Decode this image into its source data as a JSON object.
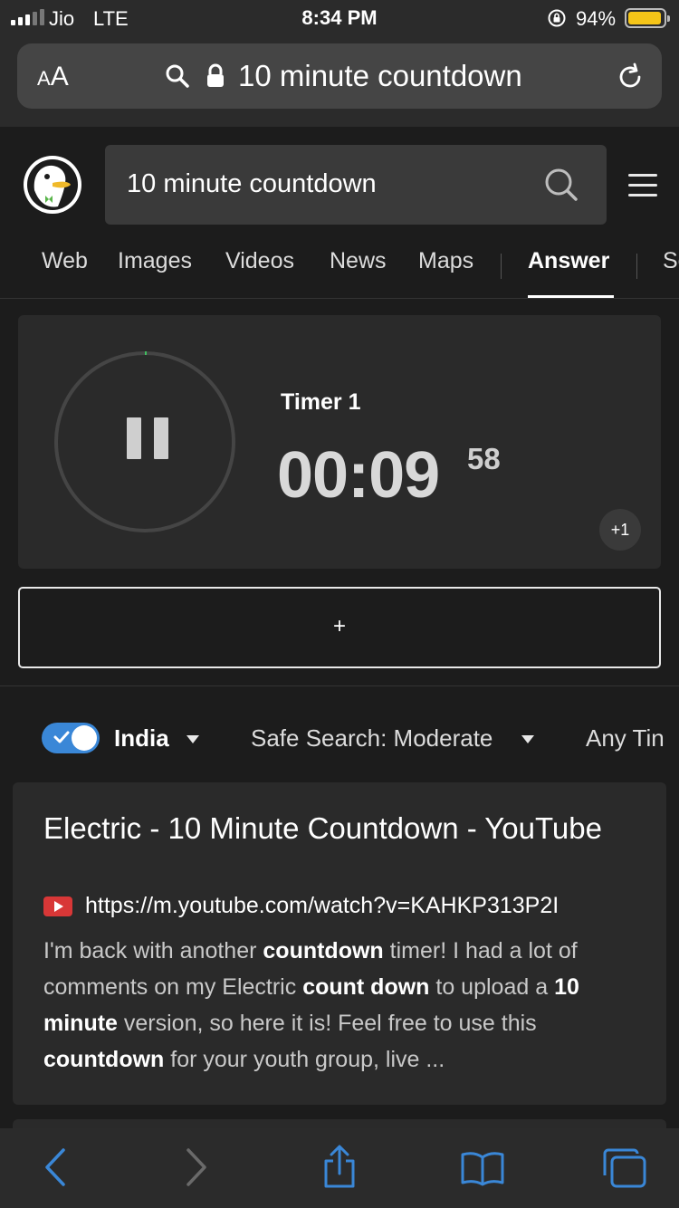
{
  "status_bar": {
    "carrier": "Jio",
    "network": "LTE",
    "time": "8:34 PM",
    "battery_percent": "94%",
    "battery_level": 0.94
  },
  "safari": {
    "text_size_label_small": "A",
    "text_size_label_large": "A",
    "address_text": "10 minute countdown"
  },
  "ddg": {
    "search_query": "10 minute countdown",
    "tabs": [
      {
        "label": "Web"
      },
      {
        "label": "Images"
      },
      {
        "label": "Videos"
      },
      {
        "label": "News"
      },
      {
        "label": "Maps"
      },
      {
        "label": "Answer"
      },
      {
        "label": "Se"
      }
    ],
    "active_tab": "Answer"
  },
  "timer": {
    "label": "Timer 1",
    "time": "00:09",
    "centiseconds": "58",
    "plus_one_label": "+1",
    "add_label": "+",
    "remaining_fraction": 0.995,
    "accent_color": "#3fbf5f"
  },
  "filters": {
    "region": "India",
    "region_enabled": true,
    "safe_search": "Safe Search: Moderate",
    "time_filter": "Any Tin"
  },
  "result": {
    "title": "Electric - 10 Minute Countdown - YouTube",
    "url": "https://m.youtube.com/watch?v=KAHKP313P2I",
    "snippet_parts": [
      {
        "text": "I'm back with another ",
        "bold": false
      },
      {
        "text": "countdown",
        "bold": true
      },
      {
        "text": " timer! I had a lot of comments on my Electric ",
        "bold": false
      },
      {
        "text": "count down",
        "bold": true
      },
      {
        "text": " to upload a ",
        "bold": false
      },
      {
        "text": "10 minute",
        "bold": true
      },
      {
        "text": " version, so here it is! Feel free to use this ",
        "bold": false
      },
      {
        "text": "countdown",
        "bold": true
      },
      {
        "text": " for your youth group, live ...",
        "bold": false
      }
    ]
  },
  "toolbar": {
    "icons": [
      "back-icon",
      "forward-icon",
      "share-icon",
      "bookmarks-icon",
      "tabs-icon"
    ]
  },
  "colors": {
    "background": "#1c1c1c",
    "card": "#2a2a2a",
    "accent_blue": "#3a87d7",
    "youtube_red": "#d83737",
    "battery_yellow": "#f5c518"
  }
}
